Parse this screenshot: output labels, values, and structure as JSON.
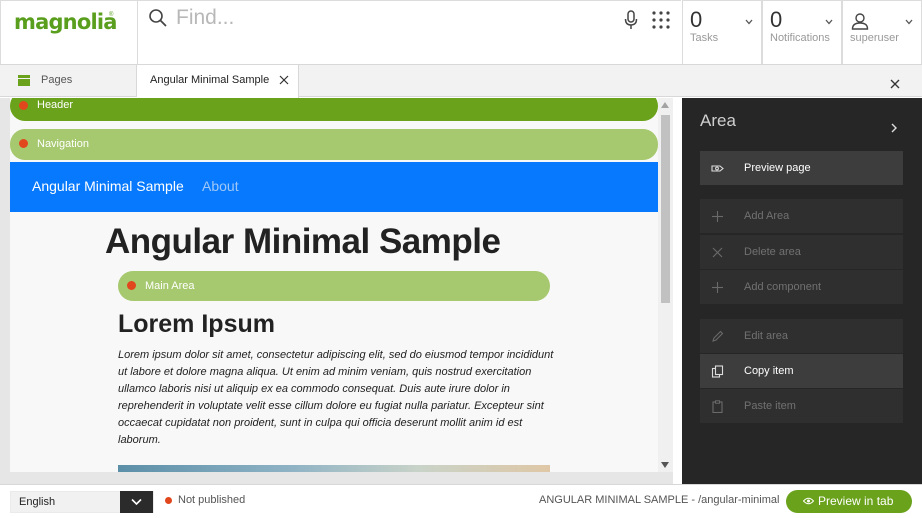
{
  "app": {
    "logo_text": "magnolia",
    "logo_mark": "®",
    "colors": {
      "brand_green": "#6aa21b",
      "light_green": "#a6c86e",
      "nav_blue": "#0779fe",
      "status_red": "#e2461d",
      "panel_dark": "#262626"
    }
  },
  "search": {
    "placeholder": "Find...",
    "icons": [
      "search-icon",
      "microphone-icon",
      "apps-grid-icon"
    ]
  },
  "tiles": {
    "tasks": {
      "count": "0",
      "label": "Tasks"
    },
    "notifications": {
      "count": "0",
      "label": "Notifications"
    },
    "user": {
      "label": "superuser",
      "icon": "user-icon"
    }
  },
  "tabs": {
    "pages": {
      "label": "Pages",
      "icon": "pages-app-icon"
    },
    "active": {
      "label": "Angular Minimal Sample"
    }
  },
  "page": {
    "areas": {
      "header": "Header",
      "navigation": "Navigation",
      "main": "Main Area"
    },
    "nav": {
      "brand": "Angular Minimal Sample",
      "about": "About"
    },
    "title": "Angular Minimal Sample",
    "content_title": "Lorem Ipsum",
    "body": "Lorem ipsum dolor sit amet, consectetur adipiscing elit, sed do eiusmod tempor incididunt ut labore et dolore magna aliqua. Ut enim ad minim veniam, quis nostrud exercitation ullamco laboris nisi ut aliquip ex ea commodo consequat. Duis aute irure dolor in reprehenderit in voluptate velit esse cillum dolore eu fugiat nulla pariatur. Excepteur sint occaecat cupidatat non proident, sunt in culpa qui officia deserunt mollit anim id est laborum."
  },
  "panel": {
    "title": "Area",
    "actions": [
      {
        "label": "Preview page",
        "icon": "preview-icon",
        "enabled": true
      },
      {
        "label": "Add Area",
        "icon": "plus-icon",
        "enabled": false
      },
      {
        "label": "Delete area",
        "icon": "x-icon",
        "enabled": false
      },
      {
        "label": "Add component",
        "icon": "plus-icon",
        "enabled": false
      },
      {
        "label": "Edit area",
        "icon": "pencil-icon",
        "enabled": false
      },
      {
        "label": "Copy item",
        "icon": "copy-icon",
        "enabled": true
      },
      {
        "label": "Paste item",
        "icon": "clipboard-icon",
        "enabled": false
      }
    ]
  },
  "footer": {
    "language": "English",
    "status": "Not published",
    "path": "ANGULAR MINIMAL SAMPLE - /angular-minimal",
    "preview_tab": "Preview in tab"
  }
}
